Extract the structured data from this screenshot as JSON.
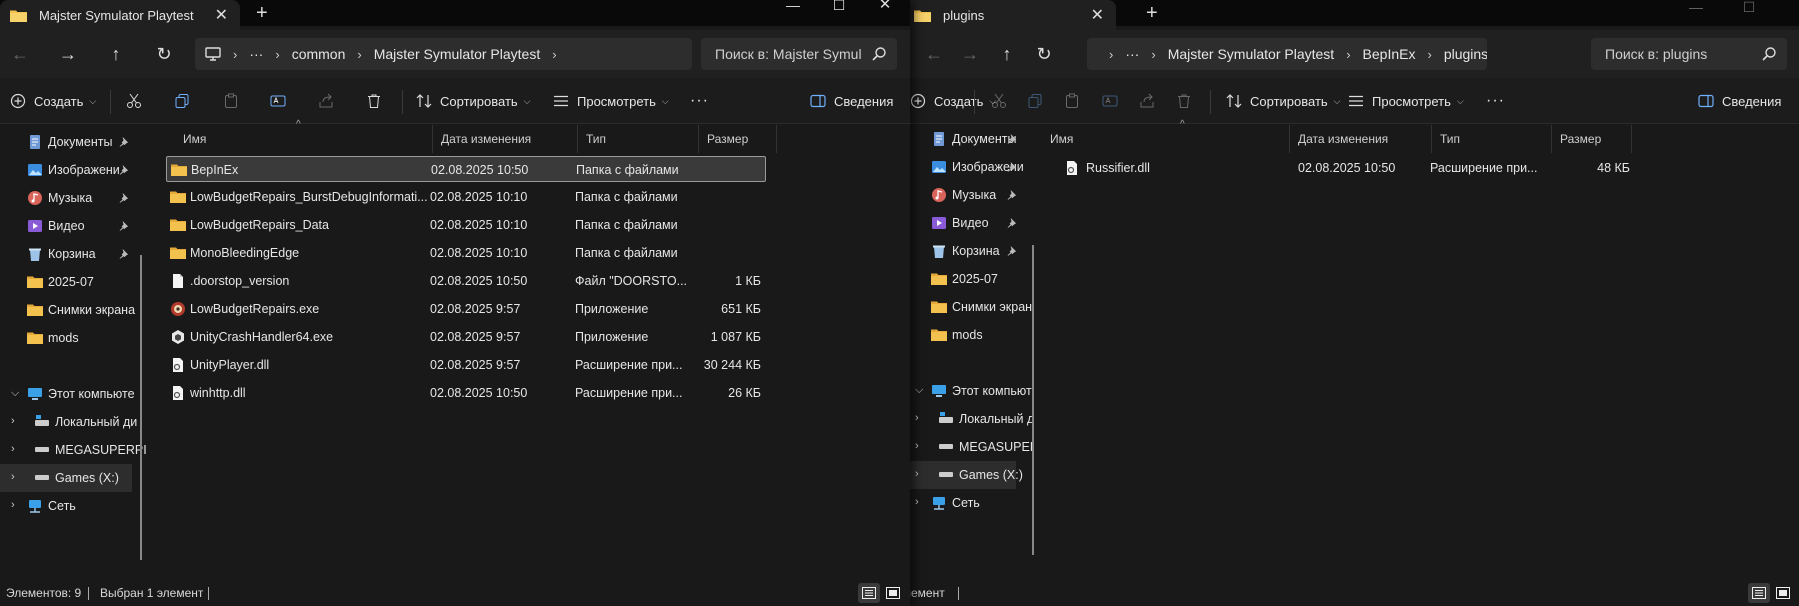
{
  "colors": {
    "folder": "#f2c14e",
    "bg": "#191919",
    "chrome": "#202020",
    "accent": "#4aa3ff"
  },
  "left": {
    "tab_title": "Majster Symulator Playtest",
    "new_tab": "+",
    "window_controls": {
      "minimize": "—",
      "maximize": "☐",
      "close": "✕"
    },
    "breadcrumb": {
      "more": "···",
      "items": [
        "common",
        "Majster Symulator Playtest"
      ]
    },
    "search_placeholder": "Поиск в: Majster Symul",
    "commands": {
      "create": "Создать",
      "sort": "Сортировать",
      "view": "Просмотреть",
      "more": "···",
      "details": "Сведения"
    },
    "columns": {
      "name": "Имя",
      "date": "Дата изменения",
      "type": "Тип",
      "size": "Размер"
    },
    "nav": {
      "quick": [
        {
          "label": "Документы",
          "icon": "documents-icon"
        },
        {
          "label": "Изображени",
          "icon": "pictures-icon"
        },
        {
          "label": "Музыка",
          "icon": "music-icon"
        },
        {
          "label": "Видео",
          "icon": "video-icon"
        },
        {
          "label": "Корзина",
          "icon": "recycle-bin-icon"
        },
        {
          "label": "2025-07",
          "icon": "folder-icon"
        },
        {
          "label": "Снимки экрана",
          "icon": "folder-icon"
        },
        {
          "label": "mods",
          "icon": "folder-icon"
        }
      ],
      "this_pc": "Этот компьюте",
      "drives": [
        "Локальный ди",
        "MEGASUPERPI",
        "Games (X:)"
      ],
      "network": "Сеть"
    },
    "files": [
      {
        "name": "BepInEx",
        "date": "02.08.2025 10:50",
        "type": "Папка с файлами",
        "size": "",
        "icon": "folder-icon",
        "selected": true
      },
      {
        "name": "LowBudgetRepairs_BurstDebugInformati...",
        "date": "02.08.2025 10:10",
        "type": "Папка с файлами",
        "size": "",
        "icon": "folder-icon"
      },
      {
        "name": "LowBudgetRepairs_Data",
        "date": "02.08.2025 10:10",
        "type": "Папка с файлами",
        "size": "",
        "icon": "folder-icon"
      },
      {
        "name": "MonoBleedingEdge",
        "date": "02.08.2025 10:10",
        "type": "Папка с файлами",
        "size": "",
        "icon": "folder-icon"
      },
      {
        "name": ".doorstop_version",
        "date": "02.08.2025 10:50",
        "type": "Файл \"DOORSTO...",
        "size": "1 КБ",
        "icon": "file-icon"
      },
      {
        "name": "LowBudgetRepairs.exe",
        "date": "02.08.2025 9:57",
        "type": "Приложение",
        "size": "651 КБ",
        "icon": "app-icon"
      },
      {
        "name": "UnityCrashHandler64.exe",
        "date": "02.08.2025 9:57",
        "type": "Приложение",
        "size": "1 087 КБ",
        "icon": "unity-icon"
      },
      {
        "name": "UnityPlayer.dll",
        "date": "02.08.2025 9:57",
        "type": "Расширение при...",
        "size": "30 244 КБ",
        "icon": "dll-icon"
      },
      {
        "name": "winhttp.dll",
        "date": "02.08.2025 10:50",
        "type": "Расширение при...",
        "size": "26 КБ",
        "icon": "dll-icon"
      }
    ],
    "status": {
      "count": "Элементов: 9",
      "selected": "Выбран 1 элемент"
    }
  },
  "right": {
    "tab_title": "plugins",
    "new_tab": "+",
    "breadcrumb": {
      "more": "···",
      "items": [
        "Majster Symulator Playtest",
        "BepInEx",
        "plugins"
      ]
    },
    "search_placeholder": "Поиск в: plugins",
    "commands": {
      "create": "Создать",
      "sort": "Сортировать",
      "view": "Просмотреть",
      "more": "···",
      "details": "Сведения"
    },
    "columns": {
      "name": "Имя",
      "date": "Дата изменения",
      "type": "Тип",
      "size": "Размер"
    },
    "nav": {
      "quick": [
        {
          "label": "Документы",
          "icon": "documents-icon"
        },
        {
          "label": "Изображени",
          "icon": "pictures-icon"
        },
        {
          "label": "Музыка",
          "icon": "music-icon"
        },
        {
          "label": "Видео",
          "icon": "video-icon"
        },
        {
          "label": "Корзина",
          "icon": "recycle-bin-icon"
        },
        {
          "label": "2025-07",
          "icon": "folder-icon"
        },
        {
          "label": "Снимки экрана",
          "icon": "folder-icon"
        },
        {
          "label": "mods",
          "icon": "folder-icon"
        }
      ],
      "this_pc": "Этот компьюте",
      "drives": [
        "Локальный ди",
        "MEGASUPERPI",
        "Games (X:)"
      ],
      "network": "Сеть"
    },
    "files": [
      {
        "name": "Russifier.dll",
        "date": "02.08.2025 10:50",
        "type": "Расширение при...",
        "size": "48 КБ",
        "icon": "dll-icon"
      }
    ],
    "status": {
      "count": "лемент"
    }
  }
}
